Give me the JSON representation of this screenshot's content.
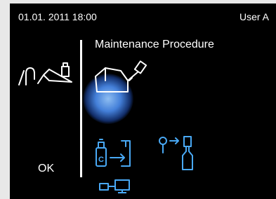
{
  "status_bar": {
    "datetime": "01.01. 2011 18:00",
    "user": "User A"
  },
  "main": {
    "title": "Maintenance Procedure"
  },
  "softkey": {
    "ok_label": "OK"
  },
  "icons": {
    "left": "instrument-handpiece-oil-icon",
    "selected": "maintenance-oil-spray-icon",
    "option_a": "oil-cartridge-insert-icon",
    "option_b": "spray-to-bottle-icon",
    "option_c": "screen-display-icon"
  },
  "colors": {
    "background": "#000000",
    "text": "#ffffff",
    "icon": "#49a9f5",
    "highlight": "#5a9cff"
  }
}
